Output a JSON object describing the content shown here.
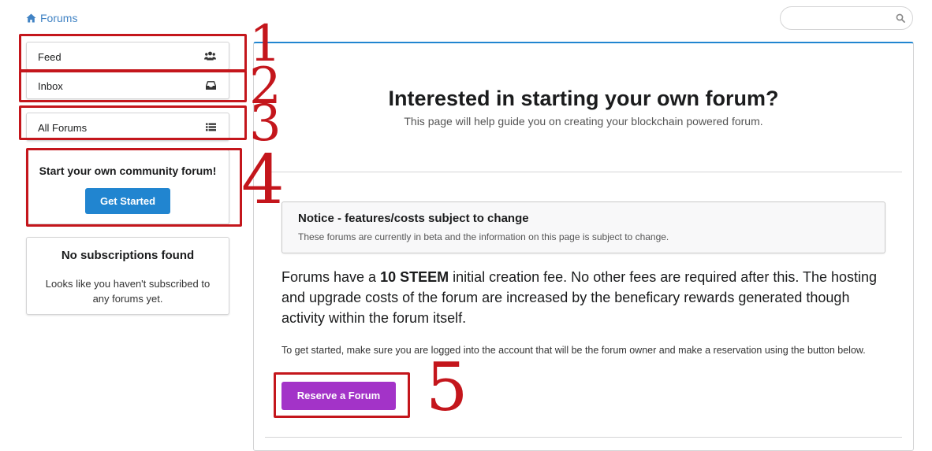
{
  "breadcrumb": {
    "label": "Forums",
    "icon": "home-icon"
  },
  "search": {
    "placeholder": "",
    "icon": "search-icon"
  },
  "sidebar": {
    "menu": [
      {
        "label": "Feed",
        "icon": "users-icon"
      },
      {
        "label": "Inbox",
        "icon": "inbox-icon"
      },
      {
        "label": "All Forums",
        "icon": "list-icon"
      }
    ],
    "cta": {
      "title": "Start your own community forum!",
      "button": "Get Started"
    },
    "subscriptions": {
      "title": "No subscriptions found",
      "text": "Looks like you haven't subscribed to any forums yet."
    }
  },
  "main": {
    "title": "Interested in starting your own forum?",
    "subtitle": "This page will help guide you on creating your blockchain powered forum.",
    "notice": {
      "title": "Notice - features/costs subject to change",
      "text": "These forums are currently in beta and the information on this page is subject to change."
    },
    "fee": {
      "before": "Forums have a ",
      "amount": "10 STEEM",
      "after": " initial creation fee. No other fees are required after this. The hosting and upgrade costs of the forum are increased by the beneficary rewards generated though activity within the forum itself."
    },
    "instructions": "To get started, make sure you are logged into the account that will be the forum owner and make a reservation using the button below.",
    "reserve_button": "Reserve a Forum"
  },
  "annotations": [
    "1",
    "2",
    "3",
    "4",
    "5"
  ],
  "colors": {
    "link": "#4183c4",
    "primary": "#2185d0",
    "purple": "#a333c8",
    "annotation": "#c4161c"
  }
}
